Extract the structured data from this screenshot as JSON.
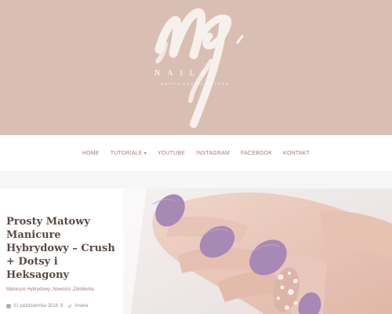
{
  "brand": {
    "name": "NAILS",
    "subtitle": "ANIELA KUBICZ MATUSA"
  },
  "nav": {
    "items": [
      {
        "label": "HOME"
      },
      {
        "label": "TUTORIALE"
      },
      {
        "label": "YOUTUBE"
      },
      {
        "label": "INSTAGRAM"
      },
      {
        "label": "FACEBOOK"
      },
      {
        "label": "KONTAKT"
      }
    ]
  },
  "post": {
    "title": "Prosty Matowy Manicure Hybrydowy – Crush + Dotsy i Heksagony",
    "categories": "Manicure Hybrydowy ,Nowości ,Zdobienia",
    "date": "31 października 2018",
    "comments": "8",
    "author": "Aniela"
  },
  "colors": {
    "header_bg": "#d9bfb3",
    "accent": "#a77c76",
    "nail_lilac": "#a888b4",
    "nail_nude": "#ddb5a8"
  }
}
